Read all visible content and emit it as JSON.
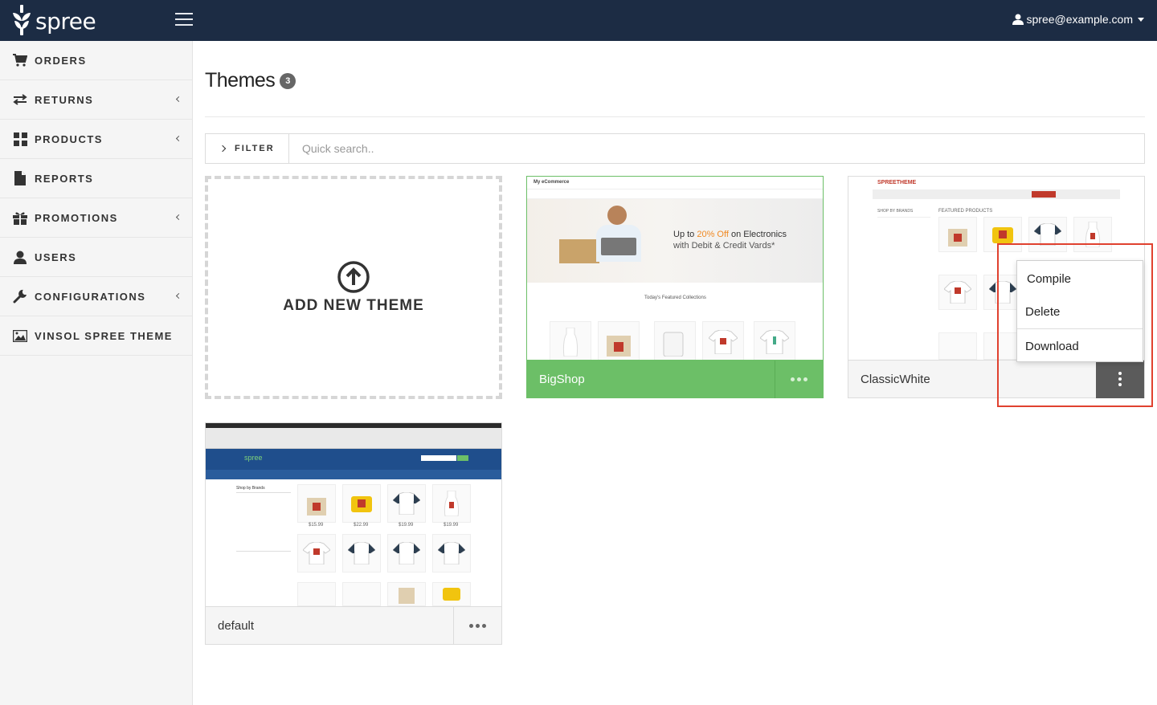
{
  "topbar": {
    "logo_text": "spree",
    "user_email": "spree@example.com"
  },
  "sidebar": {
    "items": [
      {
        "label": "ORDERS",
        "icon": "cart-icon",
        "has_submenu": false
      },
      {
        "label": "RETURNS",
        "icon": "exchange-icon",
        "has_submenu": true
      },
      {
        "label": "PRODUCTS",
        "icon": "grid-icon",
        "has_submenu": true
      },
      {
        "label": "REPORTS",
        "icon": "file-icon",
        "has_submenu": false
      },
      {
        "label": "PROMOTIONS",
        "icon": "gift-icon",
        "has_submenu": true
      },
      {
        "label": "USERS",
        "icon": "user-icon",
        "has_submenu": false
      },
      {
        "label": "CONFIGURATIONS",
        "icon": "wrench-icon",
        "has_submenu": true
      },
      {
        "label": "VINSOL SPREE THEME",
        "icon": "image-icon",
        "has_submenu": false
      }
    ]
  },
  "main": {
    "title": "Themes",
    "count": "3",
    "filter_label": "FILTER",
    "search_placeholder": "Quick search..",
    "add_label": "ADD NEW THEME",
    "themes": [
      {
        "name": "BigShop",
        "state": "active"
      },
      {
        "name": "ClassicWhite",
        "state": "menu-open"
      },
      {
        "name": "default",
        "state": "inactive"
      }
    ],
    "dropdown": {
      "items": [
        "Compile",
        "Delete",
        "Download"
      ]
    }
  },
  "previews": {
    "bigshop": {
      "brand": "My eCommerce",
      "banner_line1_pre": "Up to ",
      "banner_highlight": "20% Off",
      "banner_line1_post": " on Electronics",
      "banner_line2": "with Debit & Credit Vards*",
      "section_title": "Today's Featured Collections"
    },
    "classic": {
      "brand": "SPREETHEME",
      "section_title": "FEATURED PRODUCTS",
      "sidebar_title": "SHOP BY BRANDS"
    },
    "default": {
      "brand": "spree",
      "shop_by": "Shop by Brands",
      "prices": [
        "$15.99",
        "$22.99",
        "$19.99",
        "$19.99"
      ]
    }
  },
  "colors": {
    "topbar": "#1c2c44",
    "active_theme": "#6cbf67",
    "highlight": "#e0412f"
  }
}
